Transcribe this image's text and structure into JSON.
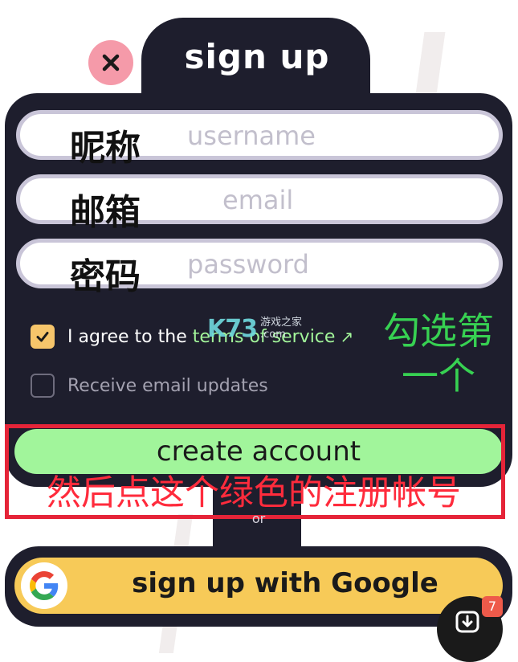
{
  "header": {
    "title": "sign up",
    "close_icon": "close-icon"
  },
  "fields": [
    {
      "annotation": "昵称",
      "placeholder": "username",
      "value": ""
    },
    {
      "annotation": "邮箱",
      "placeholder": "email",
      "value": ""
    },
    {
      "annotation": "密码",
      "placeholder": "password",
      "value": ""
    }
  ],
  "checkboxes": {
    "terms": {
      "checked": true,
      "text": "I agree to the ",
      "link": "terms of service"
    },
    "updates": {
      "checked": false,
      "text": "Receive email updates"
    }
  },
  "watermark": {
    "logo": "K73",
    "site": "游戏之家",
    "domain": ".com"
  },
  "annotations": {
    "select_first": "勾选第一个",
    "click_green": "然后点这个绿色的注册帐号"
  },
  "buttons": {
    "create_account": "create account",
    "or": "or",
    "google": "sign up with Google"
  },
  "fab": {
    "icon": "download-icon",
    "badge": "7"
  },
  "colors": {
    "panel": "#1e1e2d",
    "create_button": "#a1f59b",
    "google_button": "#f7ca58",
    "close_button": "#f59aa9",
    "checkbox_checked": "#f6c56b",
    "link": "#a2f59a",
    "annotation_green": "#37d152",
    "annotation_red": "#ff2b3c"
  }
}
